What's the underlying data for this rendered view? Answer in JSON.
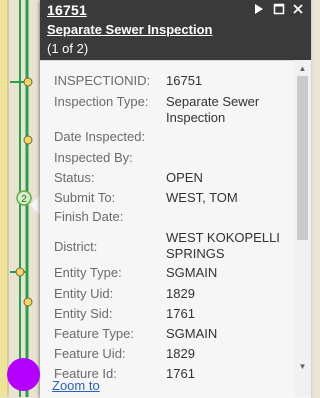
{
  "header": {
    "id_link": "16751",
    "title_link": "Separate Sewer Inspection",
    "count": "(1 of 2)"
  },
  "cluster_label": "2",
  "attributes": [
    {
      "name": "INSPECTIONID:",
      "value": "16751"
    },
    {
      "name": "Inspection Type:",
      "value": "Separate Sewer Inspection"
    },
    {
      "name": "Date Inspected:",
      "value": ""
    },
    {
      "name": "Inspected By:",
      "value": ""
    },
    {
      "name": "Status:",
      "value": "OPEN"
    },
    {
      "name": "Submit To:",
      "value": "WEST, TOM"
    },
    {
      "name": "Finish Date:",
      "value": ""
    },
    {
      "name": "District:",
      "value": "WEST KOKOPELLI SPRINGS"
    },
    {
      "name": "Entity Type:",
      "value": "SGMAIN"
    },
    {
      "name": "Entity Uid:",
      "value": "1829"
    },
    {
      "name": "Entity Sid:",
      "value": "1761"
    },
    {
      "name": "Feature Type:",
      "value": "SGMAIN"
    },
    {
      "name": "Feature Uid:",
      "value": "1829"
    },
    {
      "name": "Feature Id:",
      "value": "1761"
    }
  ],
  "zoom_to": "Zoom to",
  "icons": {
    "play": "play-icon",
    "maximize": "maximize-icon",
    "close": "close-icon"
  }
}
